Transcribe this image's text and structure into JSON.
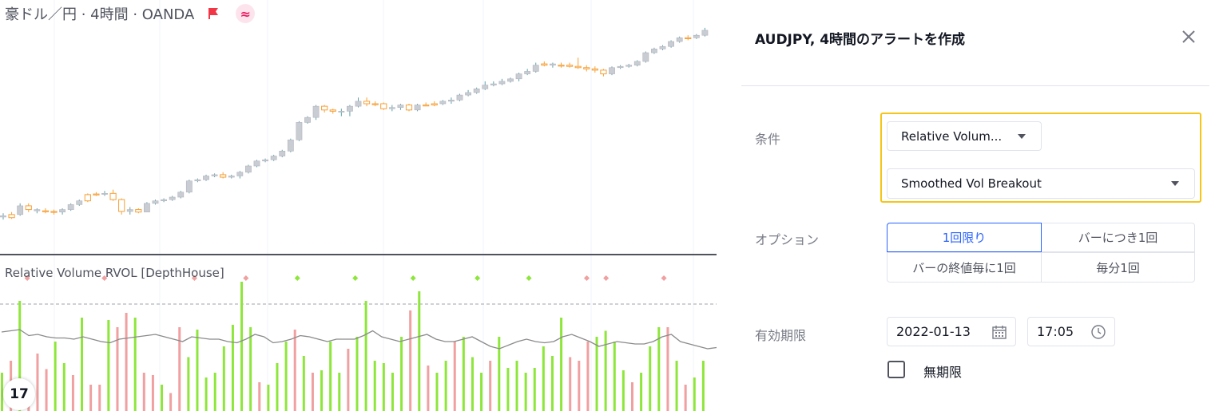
{
  "chart": {
    "symbol_label": "豪ドル／円 · 4時間 · OANDA",
    "wave_symbol": "≈",
    "flag_color": "#f23645",
    "indicator_label": "Relative Volume RVOL [DepthHouse]",
    "logo_text": "17",
    "colors": {
      "up": "#c9ccd3",
      "down": "#f7a035",
      "wick_up": "#5ca3a8",
      "wick_down": "#f7a035",
      "vol_up": "#8ee63b",
      "vol_down": "#f0a0a0",
      "avg_line": "#8a8a8a"
    }
  },
  "chart_data": {
    "type": "candlestick+bar",
    "candles": [
      [
        0,
        0.2,
        0.18,
        0.24,
        0.14
      ],
      [
        1,
        0.17,
        0.22,
        0.26,
        0.15
      ],
      [
        0,
        0.22,
        0.36,
        0.4,
        0.2
      ],
      [
        1,
        0.36,
        0.3,
        0.4,
        0.26
      ],
      [
        0,
        0.3,
        0.28,
        0.32,
        0.24
      ],
      [
        1,
        0.28,
        0.27,
        0.32,
        0.24
      ],
      [
        1,
        0.27,
        0.26,
        0.3,
        0.22
      ],
      [
        0,
        0.26,
        0.3,
        0.32,
        0.22
      ],
      [
        0,
        0.3,
        0.38,
        0.4,
        0.28
      ],
      [
        0,
        0.38,
        0.44,
        0.46,
        0.36
      ],
      [
        1,
        0.44,
        0.54,
        0.56,
        0.42
      ],
      [
        1,
        0.54,
        0.55,
        0.58,
        0.52
      ],
      [
        0,
        0.55,
        0.56,
        0.6,
        0.52
      ],
      [
        1,
        0.56,
        0.46,
        0.62,
        0.44
      ],
      [
        1,
        0.46,
        0.27,
        0.48,
        0.22
      ],
      [
        0,
        0.27,
        0.3,
        0.34,
        0.22
      ],
      [
        1,
        0.3,
        0.26,
        0.32,
        0.24
      ],
      [
        0,
        0.26,
        0.4,
        0.42,
        0.26
      ],
      [
        0,
        0.4,
        0.44,
        0.46,
        0.38
      ],
      [
        0,
        0.44,
        0.46,
        0.48,
        0.42
      ],
      [
        0,
        0.46,
        0.5,
        0.52,
        0.44
      ],
      [
        0,
        0.5,
        0.58,
        0.6,
        0.48
      ],
      [
        0,
        0.58,
        0.76,
        0.78,
        0.56
      ],
      [
        0,
        0.76,
        0.78,
        0.8,
        0.74
      ],
      [
        0,
        0.78,
        0.84,
        0.86,
        0.76
      ],
      [
        0,
        0.84,
        0.86,
        0.88,
        0.82
      ],
      [
        1,
        0.86,
        0.82,
        0.9,
        0.8
      ],
      [
        0,
        0.82,
        0.84,
        0.86,
        0.8
      ],
      [
        0,
        0.84,
        0.9,
        0.92,
        0.8
      ],
      [
        0,
        0.9,
        1.0,
        1.02,
        0.88
      ],
      [
        0,
        1.0,
        1.08,
        1.1,
        0.98
      ],
      [
        0,
        1.08,
        1.1,
        1.12,
        1.06
      ],
      [
        0,
        1.1,
        1.16,
        1.18,
        1.08
      ],
      [
        0,
        1.16,
        1.24,
        1.26,
        1.14
      ],
      [
        0,
        1.24,
        1.42,
        1.44,
        1.22
      ],
      [
        0,
        1.42,
        1.7,
        1.72,
        1.4
      ],
      [
        0,
        1.7,
        1.78,
        1.8,
        1.68
      ],
      [
        0,
        1.78,
        1.96,
        1.98,
        1.74
      ],
      [
        1,
        1.96,
        1.9,
        1.98,
        1.86
      ],
      [
        1,
        1.9,
        1.88,
        1.92,
        1.84
      ],
      [
        0,
        1.88,
        1.88,
        1.92,
        1.8
      ],
      [
        0,
        1.88,
        1.96,
        1.98,
        1.8
      ],
      [
        0,
        1.96,
        2.04,
        2.1,
        1.94
      ],
      [
        1,
        2.04,
        2.0,
        2.1,
        1.96
      ],
      [
        1,
        2.0,
        2.0,
        2.04,
        1.96
      ],
      [
        1,
        2.0,
        1.92,
        2.02,
        1.9
      ],
      [
        0,
        1.92,
        1.94,
        1.98,
        1.88
      ],
      [
        0,
        1.94,
        1.98,
        2.0,
        1.9
      ],
      [
        1,
        1.98,
        1.9,
        2.0,
        1.88
      ],
      [
        0,
        1.9,
        1.98,
        2.0,
        1.88
      ],
      [
        1,
        1.98,
        1.98,
        2.02,
        1.96
      ],
      [
        1,
        1.98,
        2.0,
        2.04,
        1.96
      ],
      [
        0,
        2.0,
        2.04,
        2.06,
        1.98
      ],
      [
        0,
        2.04,
        2.06,
        2.1,
        2.0
      ],
      [
        0,
        2.06,
        2.14,
        2.16,
        2.04
      ],
      [
        0,
        2.14,
        2.18,
        2.22,
        2.12
      ],
      [
        0,
        2.18,
        2.24,
        2.26,
        2.16
      ],
      [
        0,
        2.24,
        2.3,
        2.36,
        2.22
      ],
      [
        0,
        2.3,
        2.32,
        2.36,
        2.28
      ],
      [
        0,
        2.32,
        2.36,
        2.4,
        2.3
      ],
      [
        0,
        2.36,
        2.4,
        2.42,
        2.34
      ],
      [
        0,
        2.4,
        2.48,
        2.5,
        2.36
      ],
      [
        0,
        2.48,
        2.52,
        2.56,
        2.46
      ],
      [
        0,
        2.52,
        2.62,
        2.66,
        2.5
      ],
      [
        1,
        2.62,
        2.64,
        2.68,
        2.6
      ],
      [
        0,
        2.64,
        2.62,
        2.66,
        2.58
      ],
      [
        1,
        2.62,
        2.62,
        2.66,
        2.58
      ],
      [
        1,
        2.62,
        2.6,
        2.66,
        2.58
      ],
      [
        1,
        2.6,
        2.58,
        2.74,
        2.56
      ],
      [
        1,
        2.58,
        2.56,
        2.62,
        2.52
      ],
      [
        1,
        2.56,
        2.54,
        2.6,
        2.5
      ],
      [
        1,
        2.54,
        2.48,
        2.56,
        2.44
      ],
      [
        0,
        2.48,
        2.58,
        2.6,
        2.46
      ],
      [
        0,
        2.58,
        2.6,
        2.62,
        2.56
      ],
      [
        0,
        2.6,
        2.62,
        2.64,
        2.58
      ],
      [
        0,
        2.62,
        2.68,
        2.7,
        2.6
      ],
      [
        0,
        2.68,
        2.82,
        2.84,
        2.66
      ],
      [
        0,
        2.82,
        2.88,
        2.9,
        2.8
      ],
      [
        0,
        2.88,
        2.92,
        2.94,
        2.86
      ],
      [
        0,
        2.92,
        3.0,
        3.02,
        2.9
      ],
      [
        0,
        3.0,
        3.06,
        3.08,
        2.98
      ],
      [
        1,
        3.06,
        3.06,
        3.1,
        3.02
      ],
      [
        0,
        3.06,
        3.1,
        3.12,
        3.04
      ],
      [
        0,
        3.1,
        3.18,
        3.22,
        3.08
      ]
    ],
    "volume": [
      [
        0,
        0.32
      ],
      [
        1,
        0.42
      ],
      [
        0,
        0.92
      ],
      [
        1,
        0.2
      ],
      [
        1,
        0.48
      ],
      [
        1,
        0.35
      ],
      [
        0,
        0.58
      ],
      [
        0,
        0.4
      ],
      [
        1,
        0.3
      ],
      [
        0,
        0.78
      ],
      [
        1,
        0.22
      ],
      [
        1,
        0.22
      ],
      [
        0,
        0.76
      ],
      [
        1,
        0.7
      ],
      [
        1,
        0.82
      ],
      [
        0,
        0.78
      ],
      [
        1,
        0.32
      ],
      [
        1,
        0.3
      ],
      [
        0,
        0.22
      ],
      [
        1,
        0.15
      ],
      [
        1,
        0.7
      ],
      [
        0,
        0.45
      ],
      [
        0,
        0.68
      ],
      [
        0,
        0.28
      ],
      [
        0,
        0.32
      ],
      [
        0,
        0.54
      ],
      [
        0,
        0.72
      ],
      [
        0,
        1.08
      ],
      [
        0,
        0.7
      ],
      [
        1,
        0.24
      ],
      [
        0,
        0.22
      ],
      [
        0,
        0.4
      ],
      [
        0,
        0.58
      ],
      [
        1,
        0.68
      ],
      [
        0,
        0.46
      ],
      [
        1,
        0.32
      ],
      [
        0,
        0.34
      ],
      [
        0,
        0.58
      ],
      [
        0,
        0.32
      ],
      [
        1,
        0.52
      ],
      [
        0,
        0.62
      ],
      [
        0,
        0.92
      ],
      [
        0,
        0.42
      ],
      [
        0,
        0.4
      ],
      [
        0,
        0.32
      ],
      [
        0,
        0.62
      ],
      [
        1,
        0.84
      ],
      [
        0,
        1.0
      ],
      [
        1,
        0.38
      ],
      [
        0,
        0.32
      ],
      [
        0,
        0.42
      ],
      [
        1,
        0.58
      ],
      [
        0,
        0.62
      ],
      [
        0,
        0.45
      ],
      [
        0,
        0.32
      ],
      [
        1,
        0.42
      ],
      [
        0,
        0.62
      ],
      [
        0,
        0.36
      ],
      [
        0,
        0.42
      ],
      [
        0,
        0.32
      ],
      [
        0,
        0.36
      ],
      [
        0,
        0.54
      ],
      [
        0,
        0.46
      ],
      [
        0,
        0.78
      ],
      [
        1,
        0.45
      ],
      [
        1,
        0.42
      ],
      [
        1,
        0.58
      ],
      [
        0,
        0.62
      ],
      [
        0,
        0.67
      ],
      [
        0,
        0.58
      ],
      [
        0,
        0.34
      ],
      [
        1,
        0.24
      ],
      [
        0,
        0.32
      ],
      [
        0,
        0.54
      ],
      [
        0,
        0.7
      ],
      [
        1,
        0.7
      ],
      [
        0,
        0.42
      ],
      [
        1,
        0.22
      ],
      [
        0,
        0.28
      ],
      [
        0,
        0.42
      ]
    ],
    "avg_line": [
      0.66,
      0.67,
      0.68,
      0.63,
      0.64,
      0.62,
      0.61,
      0.61,
      0.6,
      0.62,
      0.6,
      0.58,
      0.57,
      0.6,
      0.61,
      0.62,
      0.63,
      0.64,
      0.62,
      0.6,
      0.58,
      0.62,
      0.61,
      0.6,
      0.6,
      0.58,
      0.57,
      0.6,
      0.64,
      0.62,
      0.57,
      0.58,
      0.6,
      0.63,
      0.62,
      0.6,
      0.58,
      0.6,
      0.6,
      0.6,
      0.63,
      0.67,
      0.62,
      0.6,
      0.58,
      0.6,
      0.62,
      0.64,
      0.6,
      0.58,
      0.58,
      0.6,
      0.62,
      0.58,
      0.54,
      0.52,
      0.55,
      0.58,
      0.6,
      0.58,
      0.57,
      0.58,
      0.62,
      0.64,
      0.61,
      0.58,
      0.54,
      0.56,
      0.58,
      0.57,
      0.56,
      0.56,
      0.58,
      0.62,
      0.64,
      0.58,
      0.56,
      0.54,
      0.52,
      0.53
    ],
    "dots": [
      [
        3,
        0
      ],
      [
        15,
        0
      ],
      [
        29,
        0
      ],
      [
        37,
        0
      ],
      [
        45,
        1
      ],
      [
        54,
        1
      ],
      [
        63,
        1
      ],
      [
        73,
        1
      ],
      [
        81,
        1
      ],
      [
        90,
        0
      ],
      [
        93,
        0
      ],
      [
        102,
        0
      ]
    ],
    "dot_colors": [
      "#f0a0a0",
      "#8ee63b"
    ],
    "price_grid_x": [
      68,
      200,
      335,
      480,
      605,
      740,
      868
    ]
  },
  "dialog": {
    "title": "AUDJPY, 4時間のアラートを作成",
    "close_icon": "close-icon",
    "condition": {
      "label": "条件",
      "primary": "Relative Volum...",
      "secondary": "Smoothed Vol Breakout",
      "highlight_color": "#f5c518"
    },
    "options": {
      "label": "オプション",
      "choices": [
        "1回限り",
        "バーにつき1回",
        "バーの終値毎に1回",
        "毎分1回"
      ],
      "selected": "1回限り"
    },
    "expiration": {
      "label": "有効期限",
      "date": "2022-01-13",
      "time": "17:05",
      "no_expiry_label": "無期限"
    }
  }
}
